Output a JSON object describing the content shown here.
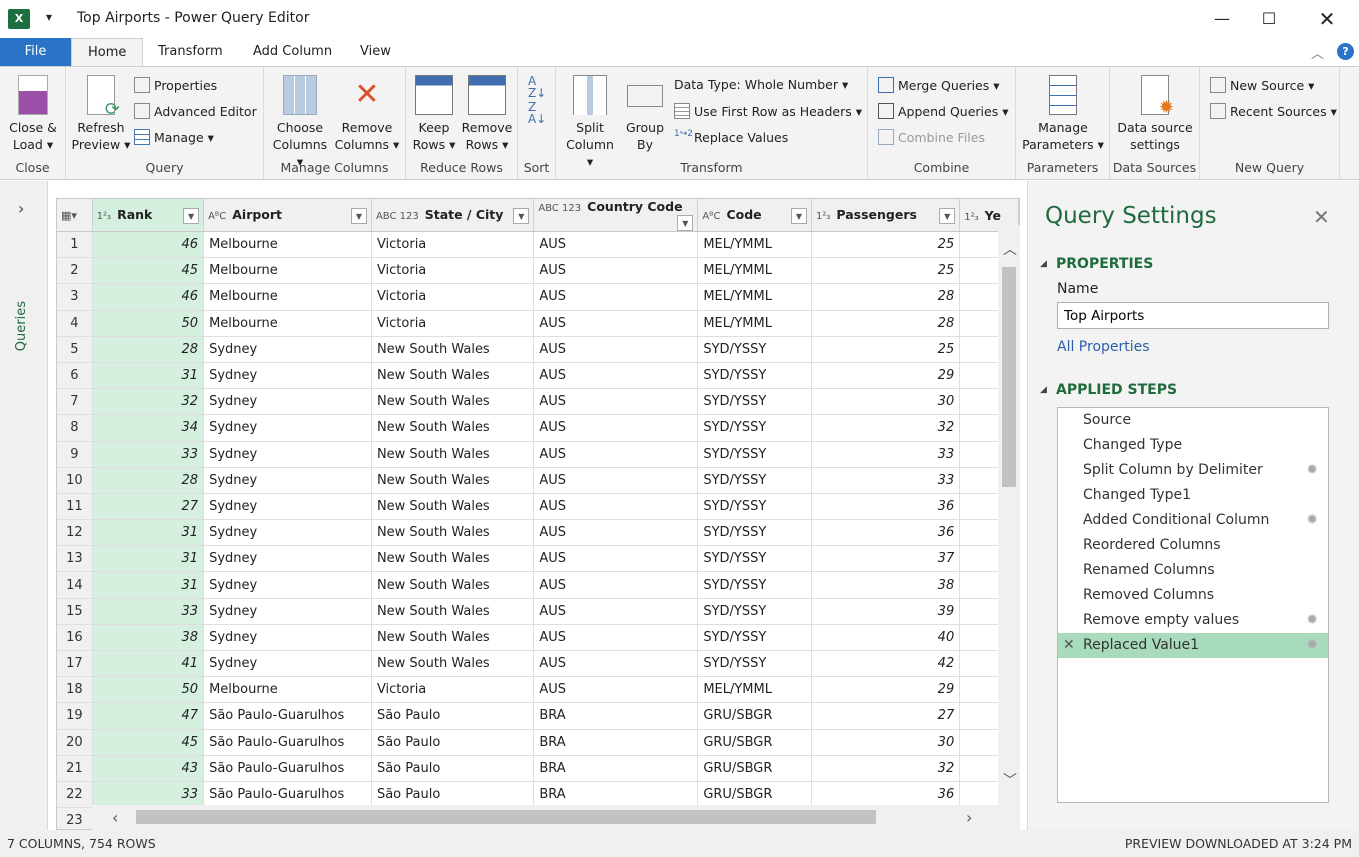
{
  "window": {
    "title": "Top Airports - Power Query Editor",
    "app_icon": "X"
  },
  "tabs": [
    "File",
    "Home",
    "Transform",
    "Add Column",
    "View"
  ],
  "ribbon": {
    "close": {
      "close_load": "Close &",
      "close_load2": "Load",
      "group": "Close"
    },
    "query": {
      "refresh": "Refresh",
      "refresh2": "Preview",
      "properties": "Properties",
      "advanced": "Advanced Editor",
      "manage": "Manage",
      "group": "Query"
    },
    "manage_columns": {
      "choose": "Choose",
      "choose2": "Columns",
      "remove": "Remove",
      "remove2": "Columns",
      "group": "Manage Columns"
    },
    "reduce_rows": {
      "keep": "Keep",
      "keep2": "Rows",
      "remove": "Remove",
      "remove2": "Rows",
      "group": "Reduce Rows"
    },
    "sort": {
      "group": "Sort"
    },
    "transform": {
      "split": "Split",
      "split2": "Column",
      "group_by": "Group",
      "group_by2": "By",
      "data_type": "Data Type: Whole Number",
      "first_row": "Use First Row as Headers",
      "replace": "Replace Values",
      "group": "Transform"
    },
    "combine": {
      "merge": "Merge Queries",
      "append": "Append Queries",
      "combine_files": "Combine Files",
      "group": "Combine"
    },
    "parameters": {
      "manage": "Manage",
      "manage2": "Parameters",
      "group": "Parameters"
    },
    "data_sources": {
      "settings": "Data source",
      "settings2": "settings",
      "group": "Data Sources"
    },
    "new_query": {
      "new_source": "New Source",
      "recent": "Recent Sources",
      "group": "New Query"
    }
  },
  "queries_pane": {
    "label": "Queries"
  },
  "grid": {
    "columns": [
      {
        "type": "1²₃",
        "name": "Rank"
      },
      {
        "type": "AᴮC",
        "name": "Airport"
      },
      {
        "type": "ABC 123",
        "name": "State / City"
      },
      {
        "type": "ABC 123",
        "name": "Country Code"
      },
      {
        "type": "AᴮC",
        "name": "Code"
      },
      {
        "type": "1²₃",
        "name": "Passengers"
      },
      {
        "type": "1²₃",
        "name": "Ye"
      }
    ],
    "rows": [
      [
        46,
        "Melbourne",
        "Victoria",
        "AUS",
        "MEL/YMML",
        25
      ],
      [
        45,
        "Melbourne",
        "Victoria",
        "AUS",
        "MEL/YMML",
        25
      ],
      [
        46,
        "Melbourne",
        "Victoria",
        "AUS",
        "MEL/YMML",
        28
      ],
      [
        50,
        "Melbourne",
        "Victoria",
        "AUS",
        "MEL/YMML",
        28
      ],
      [
        28,
        "Sydney",
        "New South Wales",
        "AUS",
        "SYD/YSSY",
        25
      ],
      [
        31,
        "Sydney",
        "New South Wales",
        "AUS",
        "SYD/YSSY",
        29
      ],
      [
        32,
        "Sydney",
        "New South Wales",
        "AUS",
        "SYD/YSSY",
        30
      ],
      [
        34,
        "Sydney",
        "New South Wales",
        "AUS",
        "SYD/YSSY",
        32
      ],
      [
        33,
        "Sydney",
        "New South Wales",
        "AUS",
        "SYD/YSSY",
        33
      ],
      [
        28,
        "Sydney",
        "New South Wales",
        "AUS",
        "SYD/YSSY",
        33
      ],
      [
        27,
        "Sydney",
        "New South Wales",
        "AUS",
        "SYD/YSSY",
        36
      ],
      [
        31,
        "Sydney",
        "New South Wales",
        "AUS",
        "SYD/YSSY",
        36
      ],
      [
        31,
        "Sydney",
        "New South Wales",
        "AUS",
        "SYD/YSSY",
        37
      ],
      [
        31,
        "Sydney",
        "New South Wales",
        "AUS",
        "SYD/YSSY",
        38
      ],
      [
        33,
        "Sydney",
        "New South Wales",
        "AUS",
        "SYD/YSSY",
        39
      ],
      [
        38,
        "Sydney",
        "New South Wales",
        "AUS",
        "SYD/YSSY",
        40
      ],
      [
        41,
        "Sydney",
        "New South Wales",
        "AUS",
        "SYD/YSSY",
        42
      ],
      [
        50,
        "Melbourne",
        "Victoria",
        "AUS",
        "MEL/YMML",
        29
      ],
      [
        47,
        "São Paulo-Guarulhos",
        "São Paulo",
        "BRA",
        "GRU/SBGR",
        27
      ],
      [
        45,
        "São Paulo-Guarulhos",
        "São Paulo",
        "BRA",
        "GRU/SBGR",
        30
      ],
      [
        43,
        "São Paulo-Guarulhos",
        "São Paulo",
        "BRA",
        "GRU/SBGR",
        32
      ],
      [
        33,
        "São Paulo-Guarulhos",
        "São Paulo",
        "BRA",
        "GRU/SBGR",
        36
      ]
    ],
    "partial_row_index": 23
  },
  "query_settings": {
    "title": "Query Settings",
    "properties_header": "PROPERTIES",
    "name_label": "Name",
    "name_value": "Top Airports",
    "all_properties": "All Properties",
    "steps_header": "APPLIED STEPS",
    "steps": [
      {
        "label": "Source",
        "gear": false
      },
      {
        "label": "Changed Type",
        "gear": false
      },
      {
        "label": "Split Column by Delimiter",
        "gear": true
      },
      {
        "label": "Changed Type1",
        "gear": false
      },
      {
        "label": "Added Conditional Column",
        "gear": true
      },
      {
        "label": "Reordered Columns",
        "gear": false
      },
      {
        "label": "Renamed Columns",
        "gear": false
      },
      {
        "label": "Removed Columns",
        "gear": false
      },
      {
        "label": "Remove empty values",
        "gear": true
      },
      {
        "label": "Replaced Value1",
        "gear": true,
        "selected": true
      }
    ]
  },
  "status": {
    "left": "7 COLUMNS, 754 ROWS",
    "right": "PREVIEW DOWNLOADED AT 3:24 PM"
  },
  "colors": {
    "file_tab": "#2b73c7",
    "accent_green": "#1f6b3c",
    "selected_step": "#a8dbbc",
    "rank_column": "#d6f0e0"
  }
}
